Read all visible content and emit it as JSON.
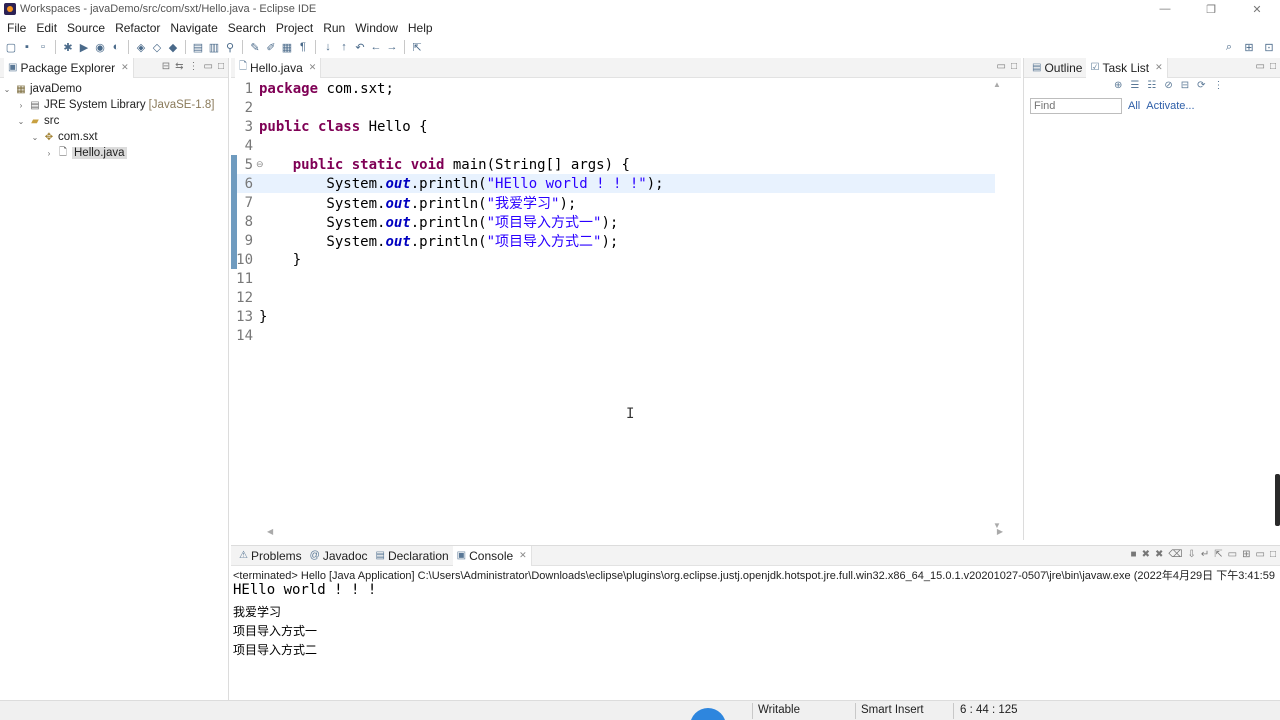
{
  "window": {
    "title": "Workspaces - javaDemo/src/com/sxt/Hello.java - Eclipse IDE",
    "minimize": "—",
    "restore": "❐",
    "close": "✕"
  },
  "menu": [
    "File",
    "Edit",
    "Source",
    "Refactor",
    "Navigate",
    "Search",
    "Project",
    "Run",
    "Window",
    "Help"
  ],
  "package_explorer": {
    "tab_label": "Package Explorer",
    "tree": [
      {
        "label": "javaDemo",
        "extra": "",
        "arrow": "⌄",
        "icon": "project-icon"
      },
      {
        "label": "JRE System Library",
        "extra": "[JavaSE-1.8]",
        "arrow": "›",
        "icon": "library-icon"
      },
      {
        "label": "src",
        "extra": "",
        "arrow": "⌄",
        "icon": "source-folder-icon"
      },
      {
        "label": "com.sxt",
        "extra": "",
        "arrow": "⌄",
        "icon": "package-icon"
      },
      {
        "label": "Hello.java",
        "extra": "",
        "arrow": "›",
        "icon": "java-file-icon"
      }
    ]
  },
  "editor": {
    "tab_label": "Hello.java",
    "current_line": 6,
    "lines": [
      {
        "n": "1",
        "tokens": [
          {
            "t": "package ",
            "c": "kw-plain"
          },
          {
            "t": "com.sxt;",
            "c": ""
          }
        ]
      },
      {
        "n": "2",
        "tokens": []
      },
      {
        "n": "3",
        "tokens": [
          {
            "t": "public class ",
            "c": "kw-plain"
          },
          {
            "t": "Hello {",
            "c": ""
          }
        ]
      },
      {
        "n": "4",
        "tokens": []
      },
      {
        "n": "5",
        "tokens": [
          {
            "t": "    public static void ",
            "c": "kw-plain"
          },
          {
            "t": "main(String[] ",
            "c": ""
          },
          {
            "t": "args",
            "c": "param"
          },
          {
            "t": ") {",
            "c": ""
          }
        ]
      },
      {
        "n": "6",
        "tokens": [
          {
            "t": "        System.",
            "c": ""
          },
          {
            "t": "out",
            "c": "fld"
          },
          {
            "t": ".println(",
            "c": ""
          },
          {
            "t": "\"HEllo world ! ! !\"",
            "c": "str"
          },
          {
            "t": ");",
            "c": ""
          }
        ]
      },
      {
        "n": "7",
        "tokens": [
          {
            "t": "        System.",
            "c": ""
          },
          {
            "t": "out",
            "c": "fld"
          },
          {
            "t": ".println(",
            "c": ""
          },
          {
            "t": "\"我爱学习\"",
            "c": "str"
          },
          {
            "t": ");",
            "c": ""
          }
        ]
      },
      {
        "n": "8",
        "tokens": [
          {
            "t": "        System.",
            "c": ""
          },
          {
            "t": "out",
            "c": "fld"
          },
          {
            "t": ".println(",
            "c": ""
          },
          {
            "t": "\"项目导入方式一\"",
            "c": "str"
          },
          {
            "t": ");",
            "c": ""
          }
        ]
      },
      {
        "n": "9",
        "tokens": [
          {
            "t": "        System.",
            "c": ""
          },
          {
            "t": "out",
            "c": "fld"
          },
          {
            "t": ".println(",
            "c": ""
          },
          {
            "t": "\"项目导入方式二\"",
            "c": "str"
          },
          {
            "t": ");",
            "c": ""
          }
        ]
      },
      {
        "n": "10",
        "tokens": [
          {
            "t": "    }",
            "c": ""
          }
        ]
      },
      {
        "n": "11",
        "tokens": []
      },
      {
        "n": "12",
        "tokens": []
      },
      {
        "n": "13",
        "tokens": [
          {
            "t": "}",
            "c": ""
          }
        ]
      },
      {
        "n": "14",
        "tokens": []
      }
    ]
  },
  "outline_panel": {
    "outline_tab": "Outline",
    "tasklist_tab": "Task List",
    "find_placeholder": "Find",
    "all_link": "All",
    "activate_link": "Activate..."
  },
  "console_panel": {
    "tabs": [
      "Problems",
      "Javadoc",
      "Declaration",
      "Console"
    ],
    "terminated_line": "<terminated> Hello [Java Application] C:\\Users\\Administrator\\Downloads\\eclipse\\plugins\\org.eclipse.justj.openjdk.hotspot.jre.full.win32.x86_64_15.0.1.v20201027-0507\\jre\\bin\\javaw.exe  (2022年4月29日 下午3:41:59",
    "output": [
      "HEllo world ! ! !",
      "我爱学习",
      "项目导入方式一",
      "项目导入方式二"
    ]
  },
  "status_bar": {
    "writable": "Writable",
    "insert_mode": "Smart Insert",
    "position": "6 : 44 : 125"
  },
  "colors": {
    "keyword": "#7f0055",
    "string": "#2a00ff",
    "field": "#0000c0",
    "current_line": "#e8f2fe",
    "gutter_mark": "#6f9bbf"
  }
}
